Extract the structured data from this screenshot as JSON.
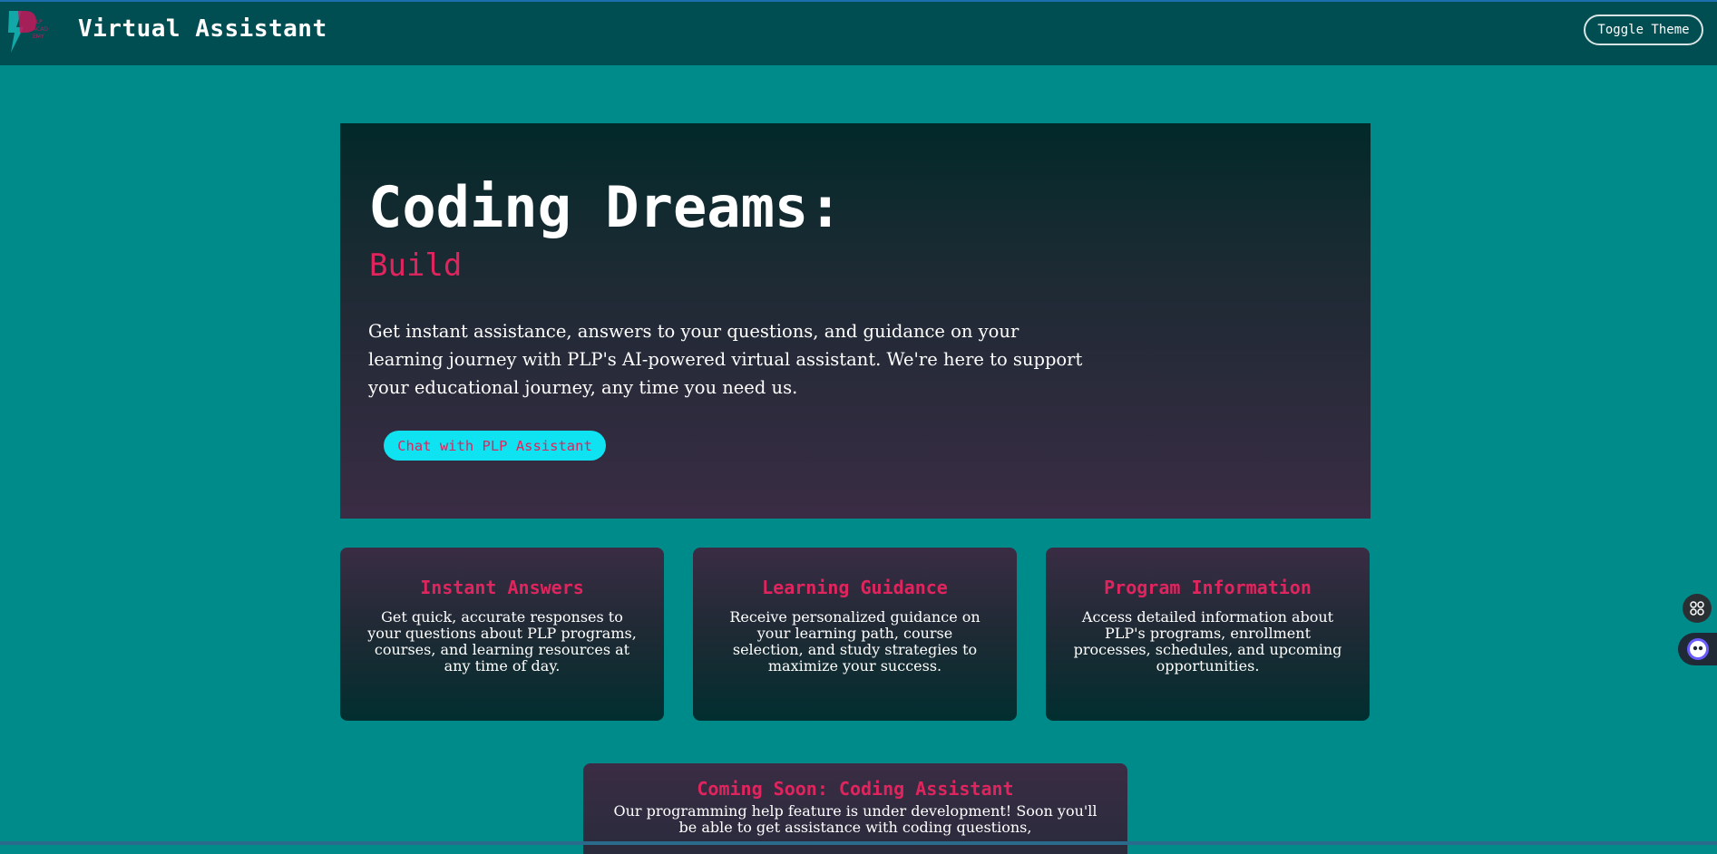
{
  "header": {
    "title": "Virtual Assistant",
    "toggle_label": "Toggle Theme",
    "logo_icon": "plp-logo-icon"
  },
  "hero": {
    "title": "Coding Dreams:",
    "subtitle": "Build",
    "description": "Get instant assistance, answers to your questions, and guidance on your learning journey with PLP's AI-powered virtual assistant. We're here to support your educational journey, any time you need us.",
    "cta_label": "Chat with PLP Assistant"
  },
  "features": [
    {
      "title": "Instant Answers",
      "text": "Get quick, accurate responses to your questions about PLP programs, courses, and learning resources at any time of day."
    },
    {
      "title": "Learning Guidance",
      "text": "Receive personalized guidance on your learning path, course selection, and study strategies to maximize your success."
    },
    {
      "title": "Program Information",
      "text": "Access detailed information about PLP's programs, enrollment processes, schedules, and upcoming opportunities."
    }
  ],
  "coming_soon": {
    "title": "Coming Soon: Coding Assistant",
    "text": "Our programming help feature is under development! Soon you'll be able to get assistance with coding questions,"
  },
  "floating": {
    "apps_icon": "command-icon",
    "chat_icon": "chatbot-icon"
  },
  "colors": {
    "page_bg": "#008b8b",
    "header_bg": "#004d52",
    "accent_pink": "#e0245e",
    "cta_cyan": "#0fe2f0"
  }
}
